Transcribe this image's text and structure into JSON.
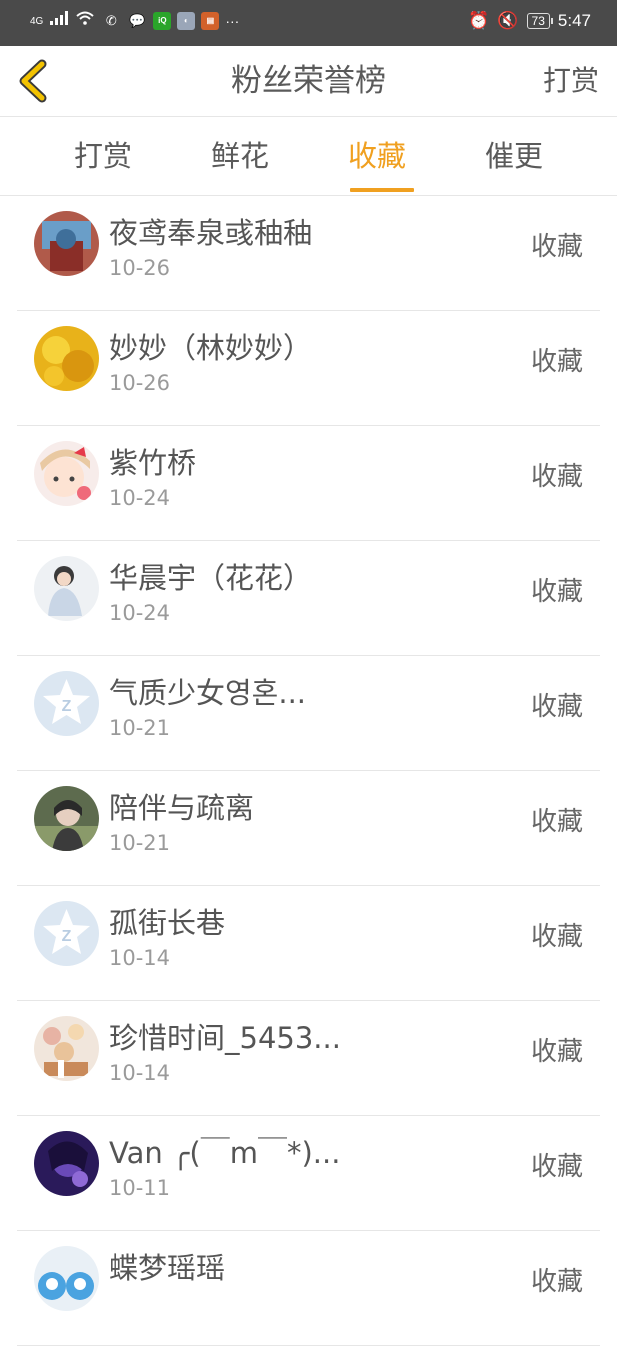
{
  "status_bar": {
    "network": "4G",
    "time": "5:47",
    "battery": "73",
    "more": "···"
  },
  "header": {
    "title": "粉丝荣誉榜",
    "action": "打赏"
  },
  "tabs": [
    {
      "label": "打赏",
      "active": false
    },
    {
      "label": "鲜花",
      "active": false
    },
    {
      "label": "收藏",
      "active": true
    },
    {
      "label": "催更",
      "active": false
    }
  ],
  "fans": [
    {
      "name": "夜鸢奉泉彧秞秞",
      "date": "10-26",
      "action": "收藏"
    },
    {
      "name": "妙妙（林妙妙）",
      "date": "10-26",
      "action": "收藏"
    },
    {
      "name": "紫竹桥",
      "date": "10-24",
      "action": "收藏"
    },
    {
      "name": "华晨宇（花花）",
      "date": "10-24",
      "action": "收藏"
    },
    {
      "name": "气质少女영혼...",
      "date": "10-21",
      "action": "收藏"
    },
    {
      "name": "陪伴与疏离",
      "date": "10-21",
      "action": "收藏"
    },
    {
      "name": "孤街长巷",
      "date": "10-14",
      "action": "收藏"
    },
    {
      "name": "珍惜时间_5453...",
      "date": "10-14",
      "action": "收藏"
    },
    {
      "name": "Van ╭(￣m￣*)...",
      "date": "10-11",
      "action": "收藏"
    },
    {
      "name": "蝶梦瑶瑶",
      "date": "",
      "action": "收藏"
    }
  ],
  "colors": {
    "accent": "#f0a020",
    "status_bar": "#4a4a4a",
    "divider": "#e6e6e6"
  }
}
